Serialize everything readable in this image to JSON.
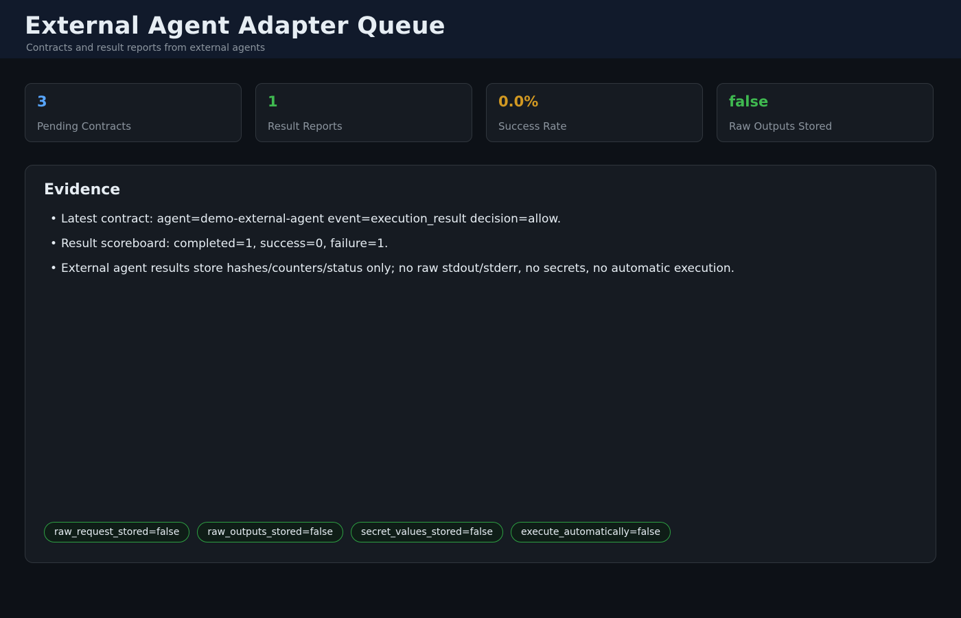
{
  "header": {
    "title": "External Agent Adapter Queue",
    "subtitle": "Contracts and result reports from external agents"
  },
  "stats": [
    {
      "value": "3",
      "label": "Pending Contracts",
      "color": "#58a6ff"
    },
    {
      "value": "1",
      "label": "Result Reports",
      "color": "#3fb950"
    },
    {
      "value": "0.0%",
      "label": "Success Rate",
      "color": "#d29922"
    },
    {
      "value": "false",
      "label": "Raw Outputs Stored",
      "color": "#3fb950"
    }
  ],
  "evidence": {
    "title": "Evidence",
    "bullet": "•",
    "items": [
      "Latest contract: agent=demo-external-agent event=execution_result decision=allow.",
      "Result scoreboard: completed=1, success=0, failure=1.",
      "External agent results store hashes/counters/status only; no raw stdout/stderr, no secrets, no automatic execution."
    ],
    "chips": [
      "raw_request_stored=false",
      "raw_outputs_stored=false",
      "secret_values_stored=false",
      "execute_automatically=false"
    ]
  },
  "colors": {
    "background": "#0d1117",
    "header_background": "#111a2b",
    "card_background": "#161b22",
    "border": "#30363d",
    "chip_border": "#2ea043"
  }
}
